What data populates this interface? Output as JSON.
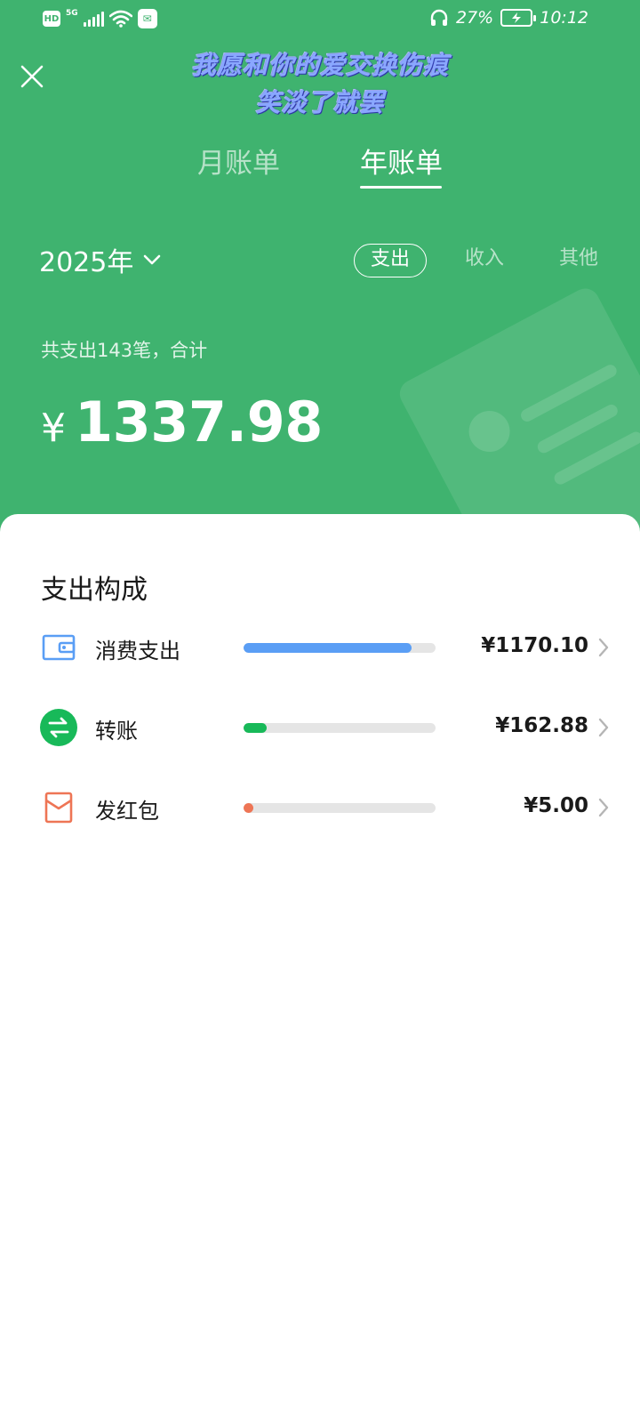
{
  "status_bar": {
    "hd": "HD",
    "network": "5G",
    "battery_percent": "27%",
    "time": "10:12"
  },
  "watermark": {
    "line1": "我愿和你的爱交换伤痕",
    "line2": "笑淡了就罢"
  },
  "tabs": [
    {
      "label": "月账单",
      "active": false
    },
    {
      "label": "年账单",
      "active": true
    }
  ],
  "year_selector": {
    "label": "2025年"
  },
  "filters": [
    {
      "label": "支出",
      "active": true
    },
    {
      "label": "收入",
      "active": false
    },
    {
      "label": "其他",
      "active": false
    }
  ],
  "summary": {
    "text": "共支出143笔，合计",
    "currency": "¥",
    "total": "1337.98"
  },
  "breakdown": {
    "title": "支出构成",
    "items": [
      {
        "label": "消费支出",
        "value": "¥1170.10",
        "fraction": 0.875,
        "color": "#5a9ef5",
        "icon": "wallet-icon"
      },
      {
        "label": "转账",
        "value": "¥162.88",
        "fraction": 0.12,
        "color": "#18b959",
        "icon": "transfer-icon"
      },
      {
        "label": "发红包",
        "value": "¥5.00",
        "fraction": 0.004,
        "color": "#ee7555",
        "icon": "red-packet-icon"
      }
    ]
  },
  "colors": {
    "header_green": "#3fb36f",
    "wallet_blue": "#5a9ef5",
    "transfer_green": "#18b959",
    "red_packet_orange": "#ee7555"
  }
}
